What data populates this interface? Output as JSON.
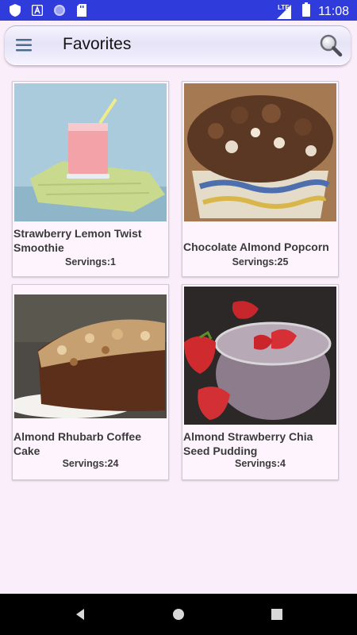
{
  "status_bar": {
    "time": "11:08",
    "left_icons": [
      "shield-icon",
      "a-box-icon",
      "circle-icon",
      "sd-card-icon"
    ],
    "network_label": "LTE",
    "battery_icon": "battery-icon"
  },
  "header": {
    "title": "Favorites",
    "menu_icon": "hamburger-menu-icon",
    "search_icon": "search-icon"
  },
  "recipes": [
    {
      "name": "Strawberry Lemon Twist Smoothie",
      "servings": "Servings:1"
    },
    {
      "name": "Chocolate Almond Popcorn",
      "servings": "Servings:25"
    },
    {
      "name": "Almond Rhubarb Coffee Cake",
      "servings": "Servings:24"
    },
    {
      "name": "Almond Strawberry Chia Seed Pudding",
      "servings": "Servings:4"
    }
  ],
  "nav_bar": {
    "back_icon": "back-triangle-icon",
    "home_icon": "home-circle-icon",
    "recents_icon": "recents-square-icon"
  }
}
